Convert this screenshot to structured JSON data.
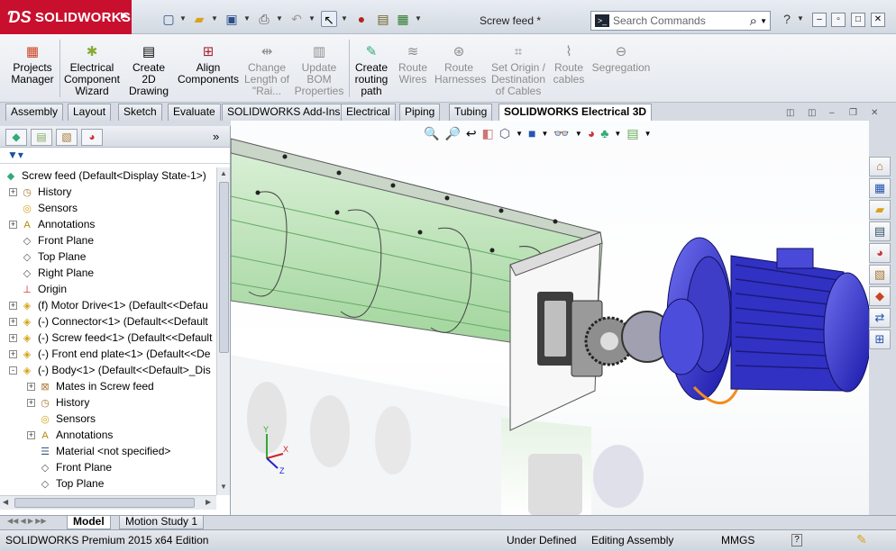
{
  "app": {
    "logo_text": "SOLIDWORKS",
    "document_title": "Screw feed *",
    "search_placeholder": "Search Commands"
  },
  "ribbon": [
    {
      "label": "Projects Manager",
      "icon": "projects-manager-icon",
      "enabled": true
    },
    {
      "label": "Electrical Component Wizard",
      "icon": "component-wizard-icon",
      "enabled": true
    },
    {
      "label": "Create 2D Drawing",
      "icon": "create-2d-drawing-icon",
      "enabled": true
    },
    {
      "label": "Align Components",
      "icon": "align-components-icon",
      "enabled": true
    },
    {
      "label": "Change Length of \"Rai...",
      "icon": "change-length-icon",
      "enabled": false
    },
    {
      "label": "Update BOM Properties",
      "icon": "update-bom-icon",
      "enabled": false
    },
    {
      "label": "Create routing path",
      "icon": "create-routing-path-icon",
      "enabled": true
    },
    {
      "label": "Route Wires",
      "icon": "route-wires-icon",
      "enabled": false
    },
    {
      "label": "Route Harnesses",
      "icon": "route-harnesses-icon",
      "enabled": false
    },
    {
      "label": "Set Origin / Destination of Cables",
      "icon": "set-origin-icon",
      "enabled": false
    },
    {
      "label": "Route cables",
      "icon": "route-cables-icon",
      "enabled": false
    },
    {
      "label": "Segregation",
      "icon": "segregation-icon",
      "enabled": false
    }
  ],
  "tabs": [
    "Assembly",
    "Layout",
    "Sketch",
    "Evaluate",
    "SOLIDWORKS Add-Ins",
    "Electrical",
    "Piping",
    "Tubing",
    "SOLIDWORKS Electrical 3D"
  ],
  "active_tab": "SOLIDWORKS Electrical 3D",
  "tree": [
    {
      "label": "Screw feed  (Default<Display State-1>)",
      "icon": "assembly-icon",
      "level": 0,
      "expander": ""
    },
    {
      "label": "History",
      "icon": "history-icon",
      "level": 1,
      "expander": "+"
    },
    {
      "label": "Sensors",
      "icon": "sensors-icon",
      "level": 1,
      "expander": ""
    },
    {
      "label": "Annotations",
      "icon": "annotations-icon",
      "level": 1,
      "expander": "+"
    },
    {
      "label": "Front Plane",
      "icon": "plane-icon",
      "level": 1,
      "expander": ""
    },
    {
      "label": "Top Plane",
      "icon": "plane-icon",
      "level": 1,
      "expander": ""
    },
    {
      "label": "Right Plane",
      "icon": "plane-icon",
      "level": 1,
      "expander": ""
    },
    {
      "label": "Origin",
      "icon": "origin-icon",
      "level": 1,
      "expander": ""
    },
    {
      "label": "(f) Motor Drive<1> (Default<<Defau",
      "icon": "subassembly-icon",
      "level": 1,
      "expander": "+"
    },
    {
      "label": "(-) Connector<1> (Default<<Default",
      "icon": "subassembly-icon",
      "level": 1,
      "expander": "+"
    },
    {
      "label": "(-) Screw feed<1> (Default<<Default",
      "icon": "subassembly-icon",
      "level": 1,
      "expander": "+"
    },
    {
      "label": "(-) Front end plate<1> (Default<<De",
      "icon": "subassembly-icon",
      "level": 1,
      "expander": "+"
    },
    {
      "label": "(-) Body<1> (Default<<Default>_Dis",
      "icon": "subassembly-icon",
      "level": 1,
      "expander": "-"
    },
    {
      "label": "Mates in Screw feed",
      "icon": "mates-icon",
      "level": 2,
      "expander": "+"
    },
    {
      "label": "History",
      "icon": "history-icon",
      "level": 2,
      "expander": "+"
    },
    {
      "label": "Sensors",
      "icon": "sensors-icon",
      "level": 2,
      "expander": ""
    },
    {
      "label": "Annotations",
      "icon": "annotations-icon",
      "level": 2,
      "expander": "+"
    },
    {
      "label": "Material <not specified>",
      "icon": "material-icon",
      "level": 2,
      "expander": ""
    },
    {
      "label": "Front Plane",
      "icon": "plane-icon",
      "level": 2,
      "expander": ""
    },
    {
      "label": "Top Plane",
      "icon": "plane-icon",
      "level": 2,
      "expander": ""
    }
  ],
  "bottom_tabs": [
    "Model",
    "Motion Study 1"
  ],
  "status": {
    "edition": "SOLIDWORKS Premium 2015 x64 Edition",
    "state": "Under Defined",
    "mode": "Editing Assembly",
    "units": "MMGS",
    "help": "?"
  },
  "triad": {
    "x": "X",
    "y": "Y",
    "z": "Z"
  },
  "colors": {
    "logo_bg": "#c8102e",
    "motor_blue": "#2a2ad4",
    "trough_green": "#b8e3b4",
    "cable_orange": "#f28c1c"
  }
}
